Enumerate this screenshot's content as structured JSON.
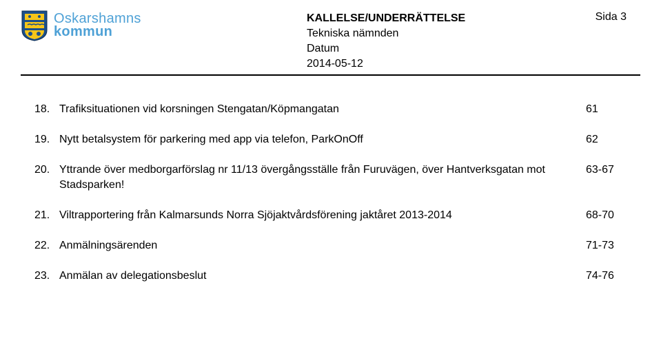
{
  "header": {
    "org_line1": "Oskarshamns",
    "org_line2": "kommun",
    "doc_title": "KALLELSE/UNDERRÄTTELSE",
    "committee": "Tekniska nämnden",
    "date_label": "Datum",
    "date_value": "2014-05-12",
    "page_label": "Sida 3"
  },
  "items": [
    {
      "num": "18.",
      "text": "Trafiksituationen vid korsningen Stengatan/Köpmangatan",
      "page": "61"
    },
    {
      "num": "19.",
      "text": "Nytt betalsystem för parkering med app via telefon, ParkOnOff",
      "page": "62"
    },
    {
      "num": "20.",
      "text": "Yttrande över medborgarförslag nr 11/13 övergångsställe från Furuvägen, över Hantverksgatan mot Stadsparken!",
      "page": "63-67"
    },
    {
      "num": "21.",
      "text": "Viltrapportering från Kalmarsunds Norra Sjöjaktvårdsförening jaktåret 2013-2014",
      "page": "68-70"
    },
    {
      "num": "22.",
      "text": "Anmälningsärenden",
      "page": "71-73"
    },
    {
      "num": "23.",
      "text": "Anmälan av delegationsbeslut",
      "page": "74-76"
    }
  ]
}
